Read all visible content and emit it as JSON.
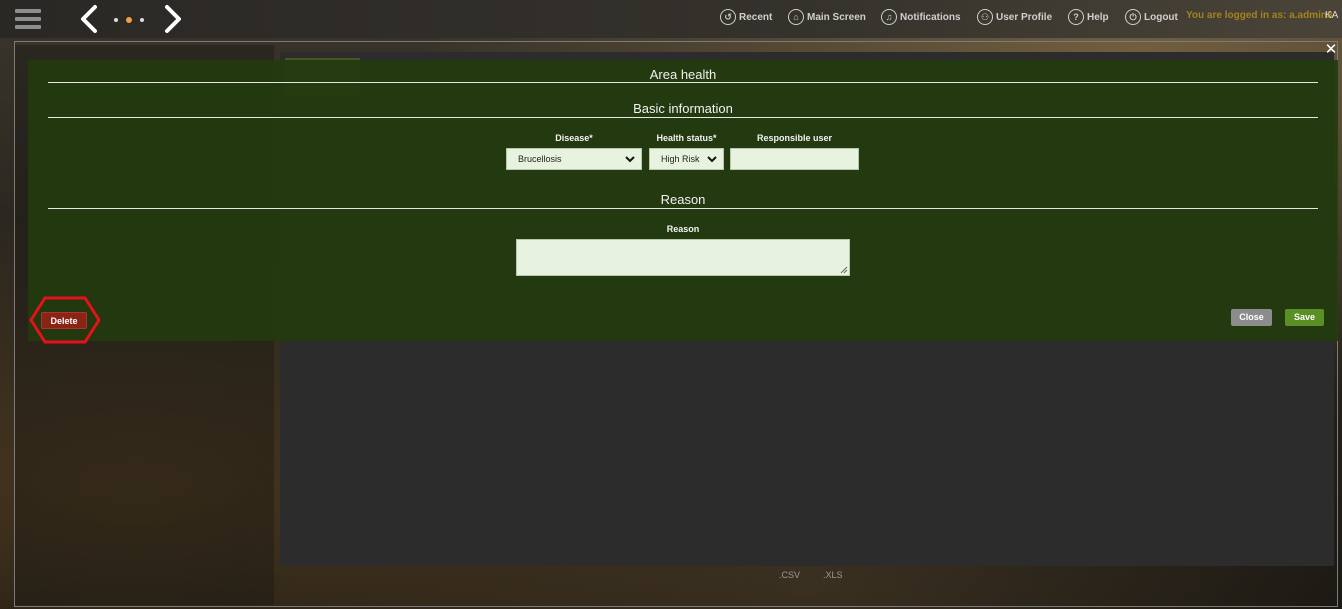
{
  "topbar": {
    "menu": [
      {
        "label": "Recent",
        "icon": "recent-icon"
      },
      {
        "label": "Main Screen",
        "icon": "home-icon"
      },
      {
        "label": "Notifications",
        "icon": "bell-icon"
      },
      {
        "label": "User Profile",
        "icon": "user-icon"
      },
      {
        "label": "Help",
        "icon": "help-icon"
      },
      {
        "label": "Logout",
        "icon": "power-icon"
      }
    ],
    "login_text": "You are logged in as: a.admin3",
    "user_initials": "KA"
  },
  "background_page": {
    "export_csv": ".CSV",
    "export_xls": ".XLS"
  },
  "modal": {
    "title": "Area health",
    "basic_info_heading": "Basic information",
    "disease": {
      "label": "Disease*",
      "value": "Brucellosis"
    },
    "health_status": {
      "label": "Health status*",
      "value": "High Risk"
    },
    "responsible_user": {
      "label": "Responsible user",
      "value": ""
    },
    "reason_heading": "Reason",
    "reason": {
      "label": "Reason",
      "value": ""
    },
    "buttons": {
      "delete": "Delete",
      "close": "Close",
      "save": "Save"
    },
    "close_glyph": "✕"
  },
  "colors": {
    "modal_bg": "#223a0e",
    "delete": "#8a2515",
    "save": "#5a8f25",
    "close": "#8c8c8c",
    "login_text": "#a5821e",
    "annotation": "#e8101a"
  }
}
